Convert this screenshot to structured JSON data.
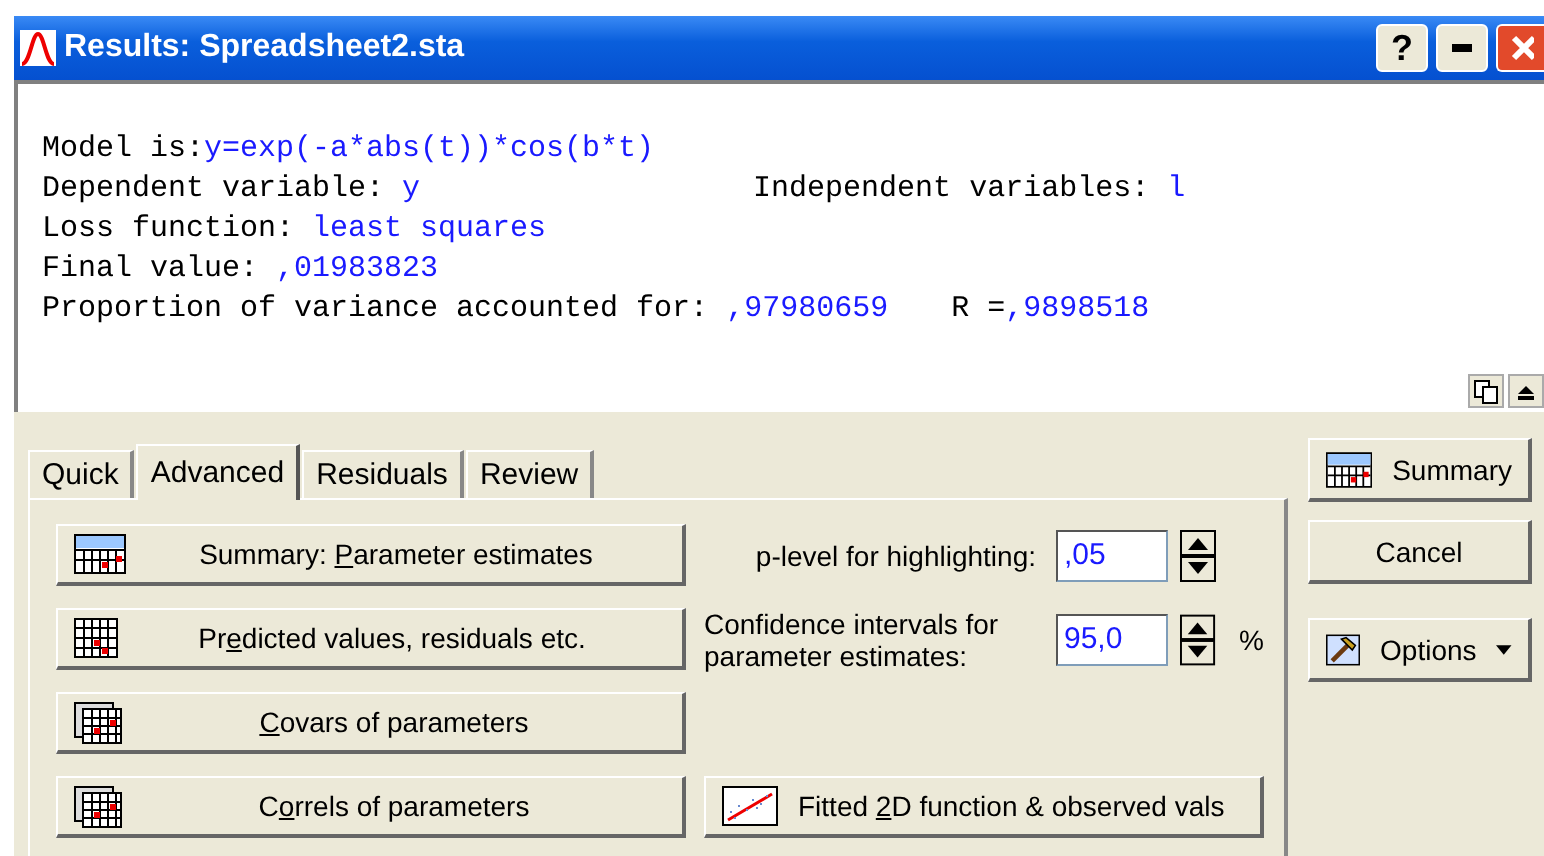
{
  "window": {
    "title": "Results: Spreadsheet2.sta",
    "help_button": "?"
  },
  "output": {
    "lines": [
      {
        "groups": [
          [
            {
              "kind": "label",
              "text": "Model is:"
            },
            {
              "kind": "value",
              "text": "y=exp(-a*abs(t))*cos(b*t)"
            }
          ]
        ]
      },
      {
        "groups": [
          [
            {
              "kind": "label",
              "text": "Dependent variable: "
            },
            {
              "kind": "value",
              "text": "y"
            }
          ],
          [
            {
              "kind": "label",
              "text": "Independent variables: "
            },
            {
              "kind": "value",
              "text": "l"
            }
          ]
        ]
      },
      {
        "groups": [
          [
            {
              "kind": "label",
              "text": "Loss function: "
            },
            {
              "kind": "value",
              "text": "least squares"
            }
          ]
        ]
      },
      {
        "groups": [
          [
            {
              "kind": "label",
              "text": "Final value: "
            },
            {
              "kind": "value",
              "text": ",01983823"
            }
          ]
        ]
      },
      {
        "groups": [
          [
            {
              "kind": "label",
              "text": "Proportion of variance accounted for: "
            },
            {
              "kind": "value",
              "text": ",97980659"
            }
          ],
          [
            {
              "kind": "label",
              "text": "R ="
            },
            {
              "kind": "value",
              "text": ",9898518"
            }
          ]
        ]
      }
    ]
  },
  "tabs": [
    {
      "label": "Quick",
      "selected": false
    },
    {
      "label": "Advanced",
      "selected": true
    },
    {
      "label": "Residuals",
      "selected": false
    },
    {
      "label": "Review",
      "selected": false
    }
  ],
  "result_buttons": [
    {
      "kind": "summary",
      "label": {
        "before": "Summary: ",
        "key": "P",
        "after": "arameter estimates"
      }
    },
    {
      "kind": "grid",
      "label": {
        "before": "Pr",
        "key": "e",
        "after": "dicted values, residuals etc."
      }
    },
    {
      "kind": "stack",
      "label": {
        "key": "C",
        "after": "ovars of parameters"
      }
    },
    {
      "kind": "stack",
      "label": {
        "before": "C",
        "key": "o",
        "after": "rrels of parameters"
      }
    }
  ],
  "settings": [
    {
      "label": "p-level for highlighting:",
      "value": ",05"
    },
    {
      "label": "Confidence intervals for parameter estimates:",
      "value": "95,0",
      "unit": "%"
    }
  ],
  "plot_button": {
    "label": {
      "before": "Fitted ",
      "key": "2",
      "after": "D function & observed vals"
    }
  },
  "side_buttons": [
    {
      "kind": "summary",
      "label": "Summary"
    },
    {
      "kind": "plain",
      "label": "Cancel"
    },
    {
      "kind": "options",
      "label": "Options"
    }
  ]
}
